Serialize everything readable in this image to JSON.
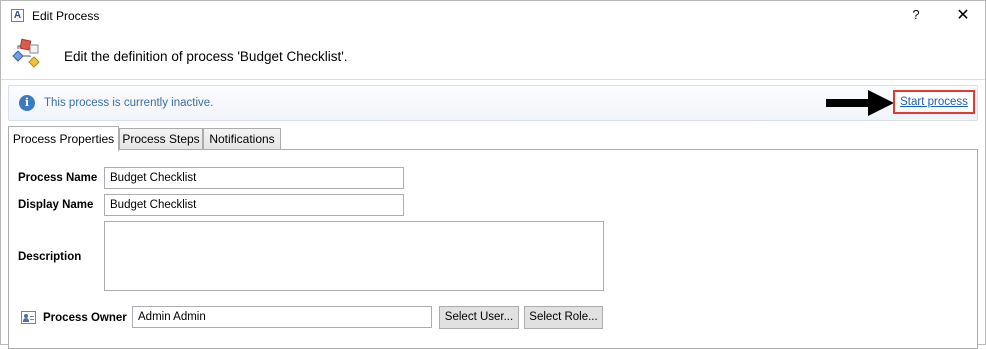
{
  "window": {
    "title": "Edit Process",
    "app_icon_letter": "A",
    "help_label": "?",
    "close_label": "✕"
  },
  "header": {
    "text": "Edit the definition of process 'Budget Checklist'.",
    "icon": "process-definition-icon"
  },
  "infobar": {
    "icon": "info-icon",
    "icon_glyph": "i",
    "message": "This process is currently inactive.",
    "action_link": "Start process"
  },
  "tabs": [
    {
      "label": "Process Properties",
      "active": true
    },
    {
      "label": "Process Steps",
      "active": false
    },
    {
      "label": "Notifications",
      "active": false
    }
  ],
  "form": {
    "process_name": {
      "label": "Process Name",
      "value": "Budget Checklist"
    },
    "display_name": {
      "label": "Display Name",
      "value": "Budget Checklist"
    },
    "description": {
      "label": "Description",
      "value": ""
    },
    "process_owner": {
      "label": "Process Owner",
      "value": "Admin Admin",
      "icon": "user-card-icon",
      "select_user_label": "Select User...",
      "select_role_label": "Select Role..."
    }
  },
  "colors": {
    "info_text": "#3a6ea5",
    "link": "#1a5fb4",
    "highlight_border": "#e53935"
  }
}
